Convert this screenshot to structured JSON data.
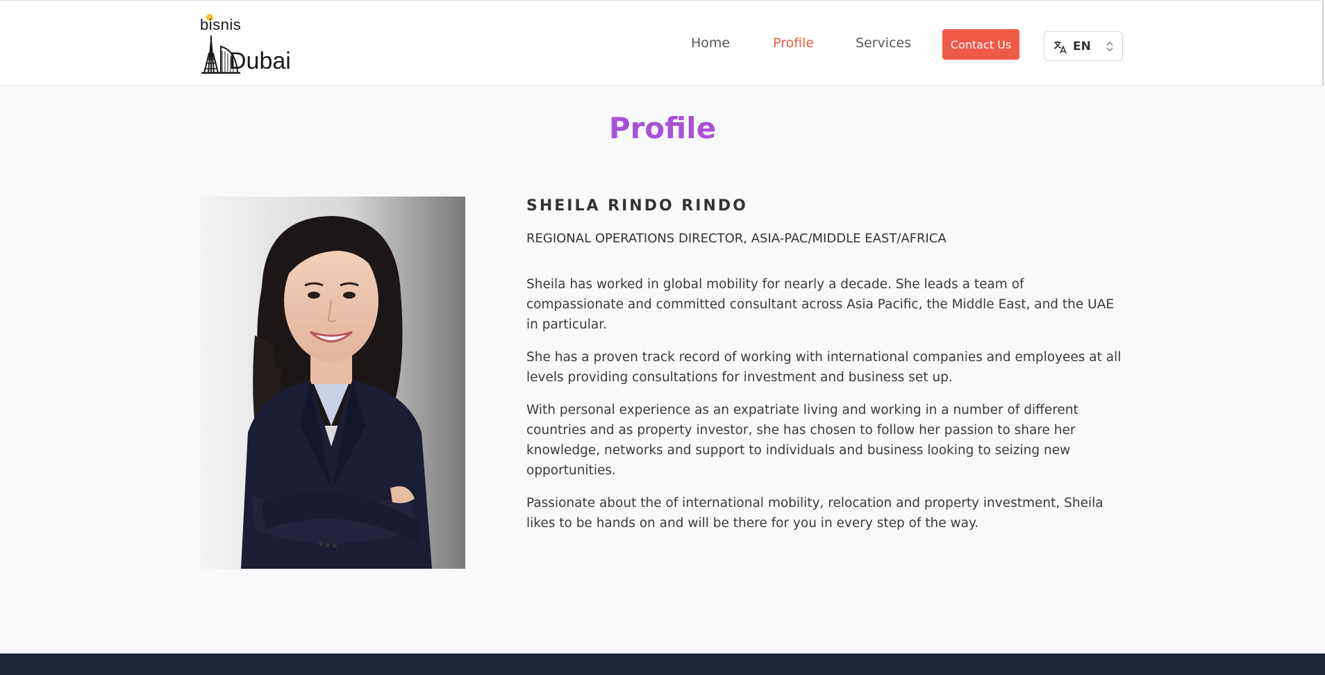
{
  "brand": {
    "logo_top": "bisnis",
    "logo_bottom": "Dubai"
  },
  "nav": {
    "items": [
      {
        "label": "Home",
        "active": false
      },
      {
        "label": "Profile",
        "active": true
      },
      {
        "label": "Services",
        "active": false
      }
    ],
    "contact_label": "Contact Us",
    "language": {
      "icon": "translate-icon",
      "selected": "EN",
      "indicator": "chevron-updown-icon"
    }
  },
  "page": {
    "title": "Profile"
  },
  "profile": {
    "photo": "portrait-photo",
    "name": "SHEILA RINDO RINDO",
    "role": "REGIONAL OPERATIONS DIRECTOR, ASIA-PAC/MIDDLE EAST/AFRICA",
    "bio": [
      "Sheila has worked in global mobility for nearly a decade. She leads a team of compassionate and committed consultant across Asia Pacific, the Middle East, and the UAE in particular.",
      "She has a proven track record of working with international companies and employees at all levels providing consultations for investment and business set up.",
      "With personal experience as an expatriate living and working in a number of different countries and as property investor, she has chosen to follow her passion to share her knowledge, networks and support to individuals and business looking to seizing new opportunities.",
      "Passionate about the of international mobility, relocation and property investment, Sheila likes to be hands on and will be there for you in every step of the way."
    ]
  },
  "colors": {
    "accent": "#ef5a47",
    "title_gradient_start": "#7b5ce6",
    "title_gradient_end": "#e355b0",
    "footer": "#1e2736",
    "background": "#f8f9fb"
  }
}
